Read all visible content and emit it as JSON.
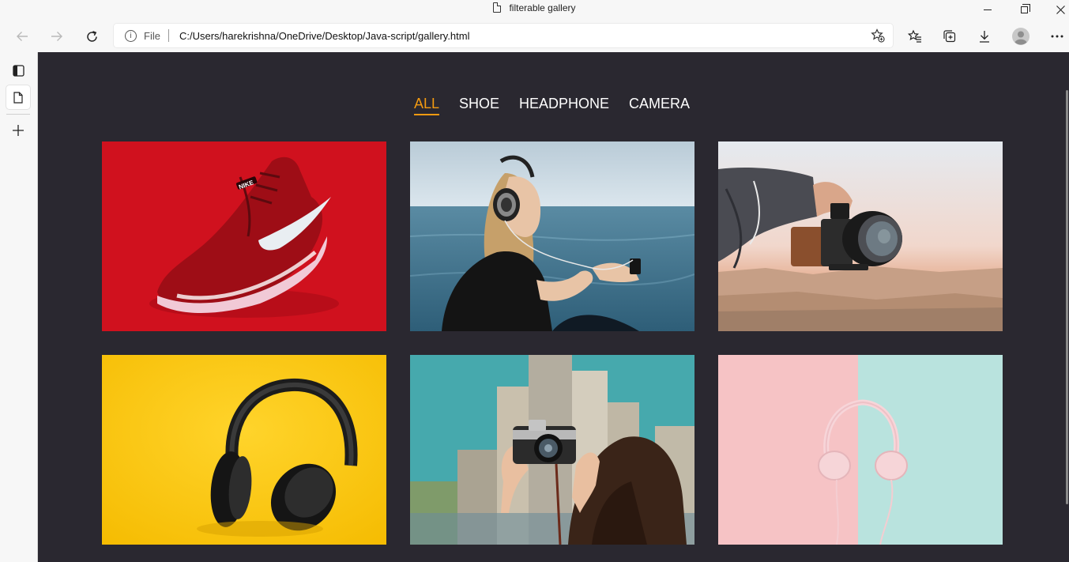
{
  "window": {
    "title": "filterable gallery"
  },
  "toolbar": {
    "address_label": "File",
    "url": "C:/Users/harekrishna/OneDrive/Desktop/Java-script/gallery.html"
  },
  "filters": [
    {
      "label": "ALL",
      "active": true
    },
    {
      "label": "SHOE",
      "active": false
    },
    {
      "label": "HEADPHONE",
      "active": false
    },
    {
      "label": "CAMERA",
      "active": false
    }
  ],
  "gallery": [
    {
      "category": "shoe",
      "subject": "red-sneaker"
    },
    {
      "category": "headphone",
      "subject": "woman-headphones-sea"
    },
    {
      "category": "camera",
      "subject": "hand-camera-desert"
    },
    {
      "category": "headphone",
      "subject": "black-headphones-yellow"
    },
    {
      "category": "camera",
      "subject": "woman-camera-city"
    },
    {
      "category": "headphone",
      "subject": "pink-headphones-pastel"
    }
  ],
  "colors": {
    "page_bg": "#2a2830",
    "accent": "#f29a11"
  }
}
